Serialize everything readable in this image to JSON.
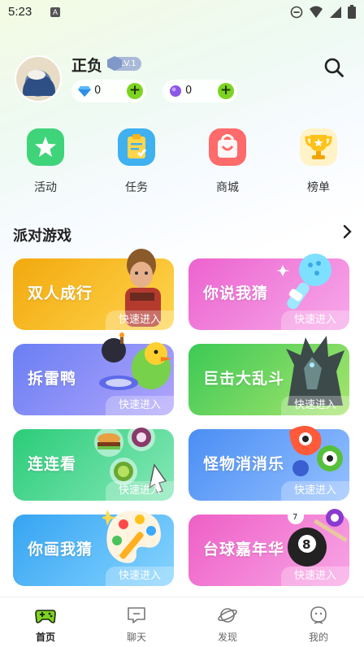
{
  "status_bar": {
    "time": "5:23",
    "notif_letter": "A"
  },
  "profile": {
    "name": "正负",
    "level": "LV.1",
    "diamonds": "0",
    "gems": "0",
    "plus": "+"
  },
  "quick_entries": [
    {
      "label": "活动",
      "icon": "star-tag-icon",
      "color": "#3fd47a"
    },
    {
      "label": "任务",
      "icon": "task-clipboard-icon",
      "color": "#3fb0f0"
    },
    {
      "label": "商城",
      "icon": "shopping-bag-icon",
      "color": "#ff6a6a"
    },
    {
      "label": "榜单",
      "icon": "trophy-icon",
      "color": "#ffc21a"
    }
  ],
  "section": {
    "title": "派对游戏"
  },
  "games": [
    {
      "title": "双人成行",
      "enter": "快速进入",
      "color_a": "#f6b718",
      "color_b": "#ffd34a"
    },
    {
      "title": "你说我猜",
      "enter": "快速进入",
      "color_a": "#ee6fd2",
      "color_b": "#f7a5e8"
    },
    {
      "title": "拆雷鸭",
      "enter": "快速进入",
      "color_a": "#6c83f4",
      "color_b": "#a9a0fb"
    },
    {
      "title": "巨击大乱斗",
      "enter": "快速进入",
      "color_a": "#3dca57",
      "color_b": "#9be36a"
    },
    {
      "title": "连连看",
      "enter": "快速进入",
      "color_a": "#2fcf7e",
      "color_b": "#7ee6b0"
    },
    {
      "title": "怪物消消乐",
      "enter": "快速进入",
      "color_a": "#4a8ff4",
      "color_b": "#8bb8ff"
    },
    {
      "title": "你画我猜",
      "enter": "快速进入",
      "color_a": "#37a6f2",
      "color_b": "#7fd0ff"
    },
    {
      "title": "台球嘉年华",
      "enter": "快速进入",
      "color_a": "#ef63c8",
      "color_b": "#f7a0e3"
    }
  ],
  "tabs": [
    {
      "label": "首页",
      "icon": "gamepad-icon",
      "active": true
    },
    {
      "label": "聊天",
      "icon": "chat-icon",
      "active": false
    },
    {
      "label": "发现",
      "icon": "planet-icon",
      "active": false
    },
    {
      "label": "我的",
      "icon": "profile-icon",
      "active": false
    }
  ]
}
